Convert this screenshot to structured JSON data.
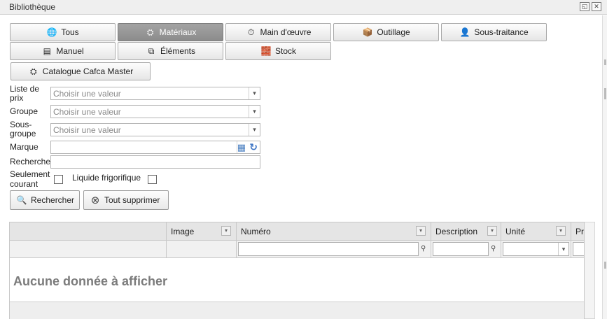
{
  "window": {
    "title": "Bibliothèque",
    "restore_glyph": "◱",
    "close_glyph": "✕"
  },
  "categories": [
    {
      "label": "Tous",
      "icon": "globe-icon",
      "glyph": "🌐"
    },
    {
      "label": "Matériaux",
      "icon": "materials-icon",
      "glyph": "⛭"
    },
    {
      "label": "Main d'œuvre",
      "icon": "stopwatch-icon",
      "glyph": "⏱"
    },
    {
      "label": "Outillage",
      "icon": "toolbox-icon",
      "glyph": "📦"
    },
    {
      "label": "Sous-traitance",
      "icon": "worker-icon",
      "glyph": "👤"
    },
    {
      "label": "Manuel",
      "icon": "document-icon",
      "glyph": "▤"
    },
    {
      "label": "Éléments",
      "icon": "elements-icon",
      "glyph": "⧉"
    },
    {
      "label": "Stock",
      "icon": "stock-icon",
      "glyph": "🧱"
    },
    {
      "label": "Catalogue Cafca Master",
      "icon": "catalogue-icon",
      "glyph": "⛭"
    }
  ],
  "filters": {
    "price_list_label_1": "Liste de",
    "price_list_label_2": "prix",
    "price_list_placeholder": "Choisir une valeur",
    "group_label": "Groupe",
    "group_placeholder": "Choisir une valeur",
    "subgroup_label_1": "Sous-",
    "subgroup_label_2": "groupe",
    "subgroup_placeholder": "Choisir une valeur",
    "brand_label": "Marque",
    "search_label": "Recherche",
    "current_only_label_1": "Seulement",
    "current_only_label_2": "courant",
    "refrigerant_label": "Liquide frigorifique",
    "dropdown_glyph": "▾",
    "calendar_glyph": "▦",
    "refresh_glyph": "↻"
  },
  "actions": {
    "search_button": "Rechercher",
    "search_glyph": "🔍",
    "clear_button": "Tout supprimer",
    "clear_glyph": "⊗"
  },
  "grid": {
    "columns": [
      {
        "label": ""
      },
      {
        "label": "Image"
      },
      {
        "label": "Numéro"
      },
      {
        "label": "Description"
      },
      {
        "label": "Unité"
      },
      {
        "label": "Pri"
      }
    ],
    "sort_glyph": "▾",
    "filter_glyph": "⚲",
    "empty_message": "Aucune donnée à afficher"
  },
  "colors": {
    "active_tab": "#999999",
    "empty_text": "#7b7b7b",
    "header_bg": "#e5e5e5"
  }
}
